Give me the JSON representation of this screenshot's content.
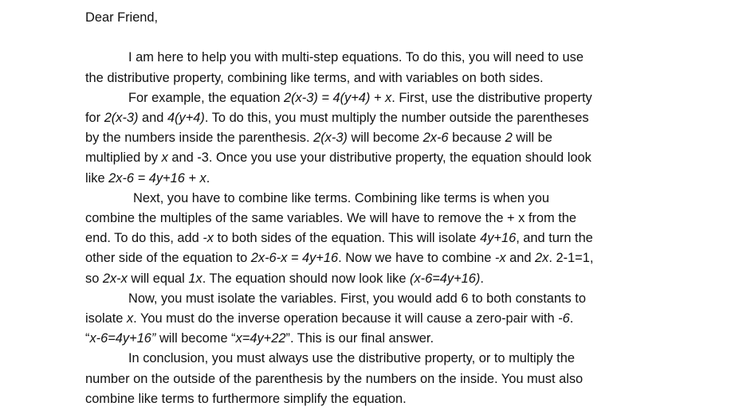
{
  "salutation": "Dear Friend,",
  "p1": {
    "l1": "I am here to help you with multi-step equations. To do this, you will need to use",
    "l2": "the distributive property, combining like terms, and with variables on both sides."
  },
  "p2": {
    "l1a": "For example, the equation ",
    "l1b": "2(x-3) = 4(y+4) + x",
    "l1c": ". First, use the distributive property",
    "l2a": "for ",
    "l2b": "2(x-3)",
    "l2c": " and ",
    "l2d": "4(y+4)",
    "l2e": ". To do this, you must multiply the number outside the parentheses",
    "l3a": "by the numbers inside the parenthesis. ",
    "l3b": "2(x-3)",
    "l3c": " will become ",
    "l3d": "2x-6",
    "l3e": " because ",
    "l3f": "2",
    "l3g": " will be",
    "l4a": "multiplied by ",
    "l4b": "x",
    "l4c": " and ",
    "l4d": "-3",
    "l4e": ". Once you use your distributive property, the equation should look",
    "l5a": "like ",
    "l5b": "2x-6 = 4y+16 + x",
    "l5c": "."
  },
  "p3": {
    "l1": "Next, you have to combine like terms. Combining like terms is when you",
    "l2": "combine the multiples of the same variables. We will have to remove the + x from the",
    "l3a": "end. To do this, add ",
    "l3b": "-x",
    "l3c": " to both sides of the equation. This will isolate ",
    "l3d": "4y+16",
    "l3e": ", and turn the",
    "l4a": "other side of the equation to ",
    "l4b": "2x-6-x = 4y+16",
    "l4c": ". Now we have to combine ",
    "l4d": "-x",
    "l4e": " and ",
    "l4f": "2x",
    "l4g": ". 2-1=1,",
    "l5a": "so ",
    "l5b": "2x-x",
    "l5c": " will equal ",
    "l5d": "1x",
    "l5e": ". The equation should now look like ",
    "l5f": "(x-6=4y+16)",
    "l5g": "."
  },
  "p4": {
    "l1": "Now, you must isolate the variables. First, you would add 6 to both constants to",
    "l2a": "isolate ",
    "l2b": "x",
    "l2c": ". You must do the inverse operation because it will cause a zero-pair with ",
    "l2d": "-6",
    "l2e": ".",
    "l3a": "“",
    "l3b": "x-6=4y+16”",
    "l3c": " will become “",
    "l3d": "x=4y+22",
    "l3e": "”. This is our final answer."
  },
  "p5": {
    "l1": "In conclusion, you must always use the distributive property, or to multiply the",
    "l2": "number on the outside of the parenthesis by the numbers on the inside. You must also",
    "l3": "combine like terms to furthermore simplify the equation."
  }
}
